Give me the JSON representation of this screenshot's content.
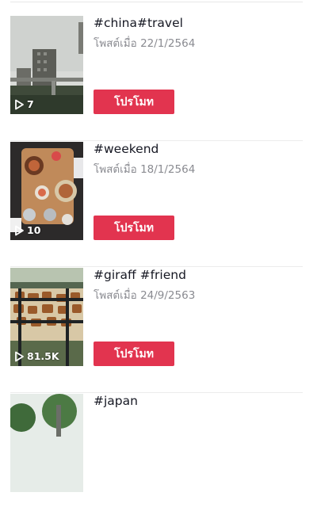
{
  "posts": [
    {
      "caption": "#china#travel",
      "posted": "โพสต์เมื่อ 22/1/2564",
      "views": "7",
      "promote_label": "โปรโมท"
    },
    {
      "caption": "#weekend",
      "posted": "โพสต์เมื่อ 18/1/2564",
      "views": "10",
      "promote_label": "โปรโมท"
    },
    {
      "caption": "#giraff #friend",
      "posted": "โพสต์เมื่อ 24/9/2563",
      "views": "81.5K",
      "promote_label": "โปรโมท"
    },
    {
      "caption": "#japan",
      "posted": "",
      "views": "",
      "promote_label": ""
    }
  ],
  "colors": {
    "promote_button": "#e2344f",
    "date_text": "#8a8b91",
    "caption_text": "#161823"
  },
  "icons": {
    "views": "play-outline-icon"
  }
}
